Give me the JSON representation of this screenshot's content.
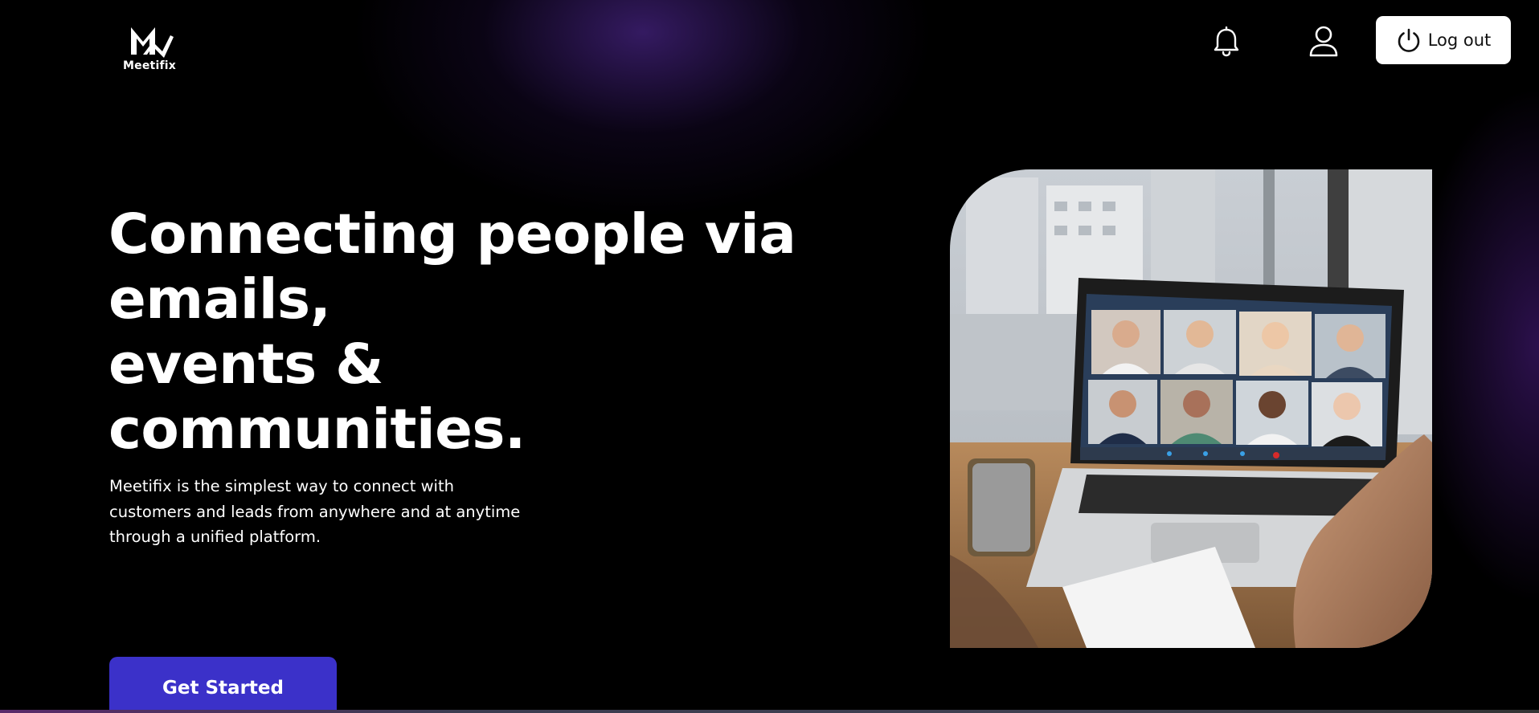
{
  "header": {
    "logo_text": "Meetifix",
    "notifications_icon": "bell-icon",
    "profile_icon": "user-icon",
    "logout_icon": "power-icon",
    "logout_label": "Log out"
  },
  "hero": {
    "headline_lines": [
      "Connecting people via",
      "emails,",
      "events & communities."
    ],
    "description_lines": [
      "Meetifix is the simplest way to connect with",
      "customers and leads from anywhere and at anytime",
      "through a unified platform."
    ],
    "cta_label": "Get Started",
    "image_subject": "video-conference-laptop-photo"
  },
  "colors": {
    "background": "#000000",
    "accent_glow": "#3a1c6e",
    "cta": "#3b31c9",
    "logout_bg": "#ffffff"
  }
}
